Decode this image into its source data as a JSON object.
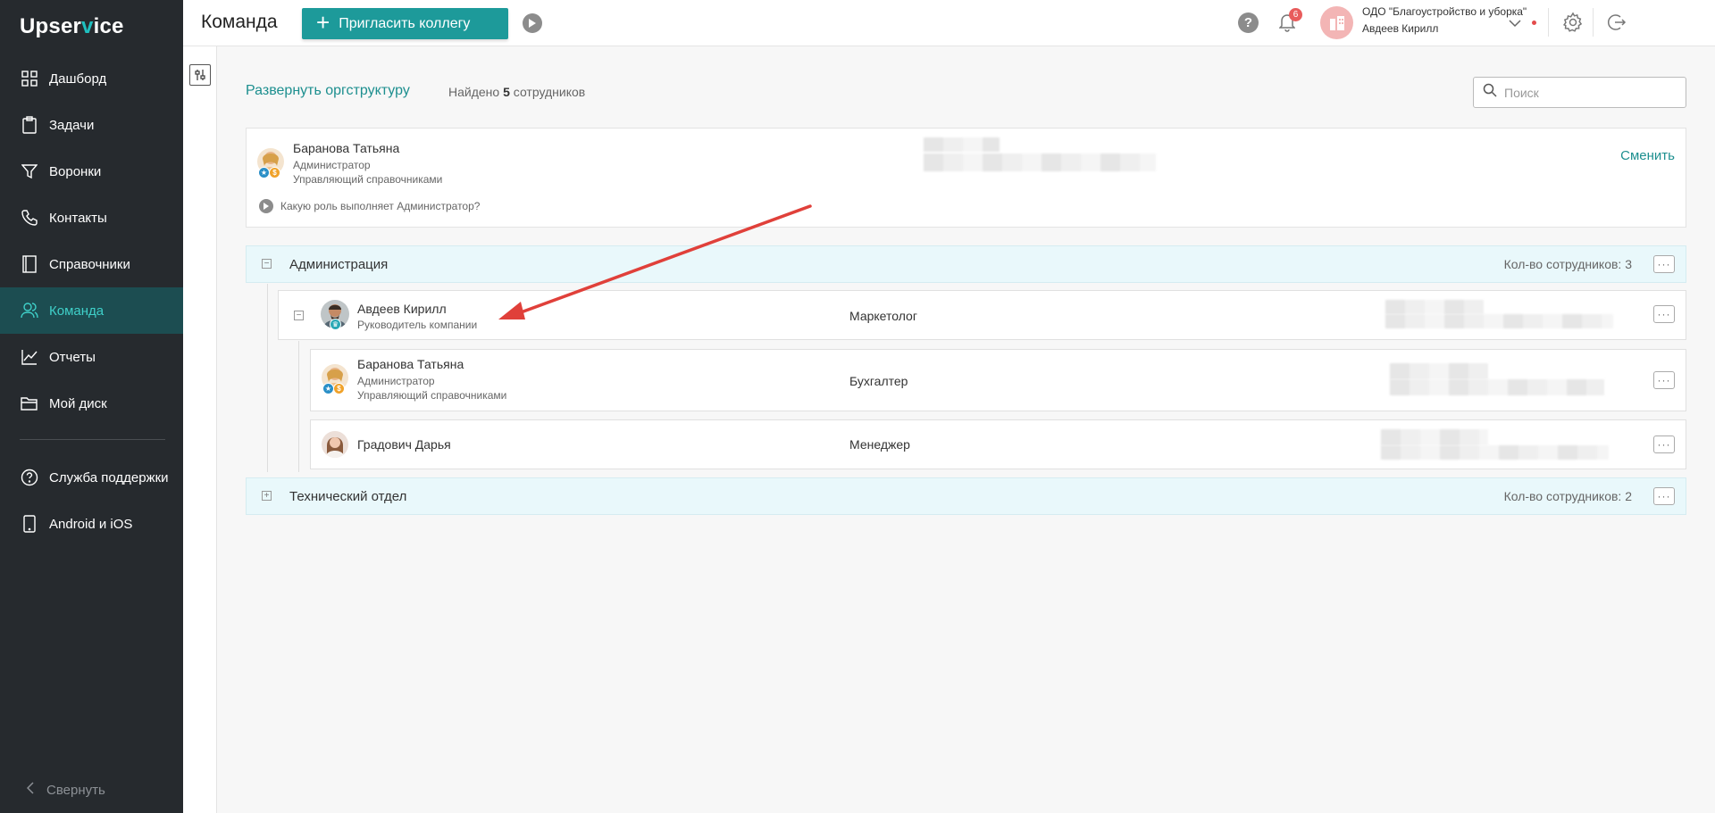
{
  "sidebar": {
    "logo_prefix": "Upser",
    "logo_v": "v",
    "logo_suffix": "ice",
    "items": [
      {
        "label": "Дашборд",
        "icon": "grid-icon"
      },
      {
        "label": "Задачи",
        "icon": "clipboard-icon"
      },
      {
        "label": "Воронки",
        "icon": "funnel-icon"
      },
      {
        "label": "Контакты",
        "icon": "phone-icon"
      },
      {
        "label": "Справочники",
        "icon": "book-icon"
      },
      {
        "label": "Команда",
        "icon": "users-icon",
        "active": true
      },
      {
        "label": "Отчеты",
        "icon": "chart-icon"
      },
      {
        "label": "Мой диск",
        "icon": "folder-icon"
      },
      {
        "label": "Служба поддержки",
        "icon": "help-circle-icon"
      },
      {
        "label": "Android и iOS",
        "icon": "mobile-icon"
      }
    ],
    "collapse_label": "Свернуть"
  },
  "header": {
    "title": "Команда",
    "invite_label": "Пригласить коллегу",
    "help_label": "?",
    "notifications_count": "6",
    "org_name": "ОДО \"Благоустройство и уборка\"",
    "user_name": "Авдеев Кирилл"
  },
  "toolbar": {
    "expand_label": "Развернуть оргструктуру",
    "found_prefix": "Найдено",
    "found_count": "5",
    "found_suffix": "сотрудников",
    "search_placeholder": "Поиск"
  },
  "admin_card": {
    "name": "Баранова Татьяна",
    "role1": "Администратор",
    "role2": "Управляющий справочниками",
    "hint": "Какую роль выполняет Администратор?",
    "change_label": "Сменить"
  },
  "departments": [
    {
      "name": "Администрация",
      "count_label": "Кол-во сотрудников: 3",
      "expanded": true,
      "head": {
        "name": "Авдеев Кирилл",
        "role": "Руководитель компании",
        "position": "Маркетолог"
      },
      "employees": [
        {
          "name": "Баранова Татьяна",
          "role1": "Администратор",
          "role2": "Управляющий справочниками",
          "position": "Бухгалтер"
        },
        {
          "name": "Градович Дарья",
          "position": "Менеджер"
        }
      ]
    },
    {
      "name": "Технический отдел",
      "count_label": "Кол-во сотрудников: 2",
      "expanded": false
    }
  ],
  "more_label": "···",
  "colors": {
    "accent": "#1d9a9a",
    "sidebar_bg": "#262a2e",
    "active_bg": "#1c4d51",
    "annotation_arrow": "#e0403a"
  }
}
